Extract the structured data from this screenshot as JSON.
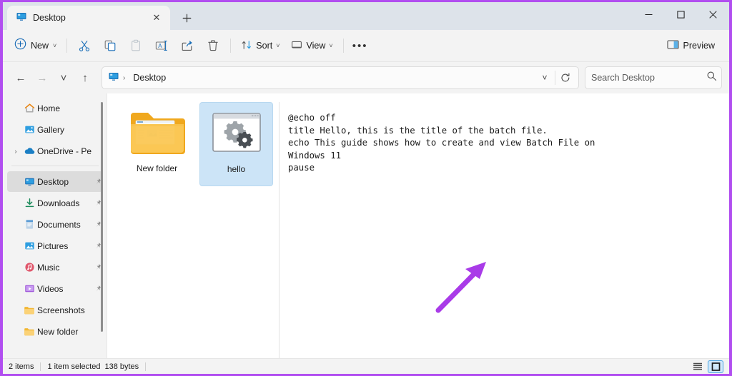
{
  "window": {
    "annotation_color": "#a93be8",
    "accent_color": "#0f6cbd",
    "selection_color": "#cce4f7"
  },
  "tabs": {
    "items": [
      {
        "label": "Desktop",
        "icon": "desktop-monitor-icon",
        "active": true
      }
    ],
    "close_glyph": "✕",
    "new_tab_glyph": "＋"
  },
  "window_controls": {
    "minimize": "Minimize",
    "maximize": "Maximize",
    "close": "Close"
  },
  "toolbar": {
    "new_label": "New",
    "new_icon": "plus-circle-icon",
    "chevron": "˅",
    "buttons": [
      {
        "name": "cut",
        "label": "Cut",
        "icon": "scissors-icon",
        "disabled": false
      },
      {
        "name": "copy",
        "label": "Copy",
        "icon": "copy-icon",
        "disabled": false
      },
      {
        "name": "paste",
        "label": "Paste",
        "icon": "clipboard-icon",
        "disabled": true
      },
      {
        "name": "rename",
        "label": "Rename",
        "icon": "rename-icon",
        "disabled": false
      },
      {
        "name": "share",
        "label": "Share",
        "icon": "share-icon",
        "disabled": false
      },
      {
        "name": "delete",
        "label": "Delete",
        "icon": "trash-icon",
        "disabled": false
      }
    ],
    "sort_label": "Sort",
    "sort_icon": "sort-arrows-icon",
    "view_label": "View",
    "view_icon": "monitor-icon",
    "overflow_label": "•••",
    "preview_label": "Preview",
    "preview_icon": "preview-pane-icon"
  },
  "address_bar": {
    "back_glyph": "←",
    "forward_glyph": "→",
    "recent_glyph": "˅",
    "up_glyph": "↑",
    "breadcrumb": {
      "icon": "desktop-monitor-icon",
      "separator": "›",
      "path": "Desktop"
    },
    "dropdown_glyph": "˅",
    "refresh_glyph": "⟳"
  },
  "search": {
    "placeholder": "Search Desktop",
    "value": "",
    "icon": "search-icon"
  },
  "sidebar": {
    "items": [
      {
        "label": "Home",
        "icon": "home-icon",
        "pinned": false,
        "expandable": false,
        "selected": false
      },
      {
        "label": "Gallery",
        "icon": "gallery-icon",
        "pinned": false,
        "expandable": false,
        "selected": false
      },
      {
        "label": "OneDrive - Pers",
        "icon": "onedrive-cloud-icon",
        "pinned": false,
        "expandable": true,
        "selected": false
      },
      {
        "divider": true
      },
      {
        "label": "Desktop",
        "icon": "desktop-monitor-icon",
        "pinned": true,
        "expandable": false,
        "selected": true
      },
      {
        "label": "Downloads",
        "icon": "download-icon",
        "pinned": true,
        "expandable": false,
        "selected": false
      },
      {
        "label": "Documents",
        "icon": "document-icon",
        "pinned": true,
        "expandable": false,
        "selected": false
      },
      {
        "label": "Pictures",
        "icon": "pictures-icon",
        "pinned": true,
        "expandable": false,
        "selected": false
      },
      {
        "label": "Music",
        "icon": "music-icon",
        "pinned": true,
        "expandable": false,
        "selected": false
      },
      {
        "label": "Videos",
        "icon": "video-icon",
        "pinned": true,
        "expandable": false,
        "selected": false
      },
      {
        "label": "Screenshots",
        "icon": "folder-icon",
        "pinned": false,
        "expandable": false,
        "selected": false
      },
      {
        "label": "New folder",
        "icon": "folder-icon",
        "pinned": false,
        "expandable": false,
        "selected": false
      }
    ],
    "pin_glyph": "📌",
    "expander_glyph": "›"
  },
  "files": {
    "items": [
      {
        "name": "New folder",
        "icon": "folder-with-preview-icon",
        "selected": false
      },
      {
        "name": "hello",
        "icon": "batch-file-gears-icon",
        "selected": true
      }
    ]
  },
  "preview": {
    "content": "@echo off\ntitle Hello, this is the title of the batch file.\necho This guide shows how to create and view Batch File on Windows 11\npause"
  },
  "status_bar": {
    "item_count": "2 items",
    "selection": "1 item selected",
    "size": "138 bytes",
    "view_buttons": [
      {
        "name": "details-view",
        "label": "Details view",
        "active": false
      },
      {
        "name": "large-icons-view",
        "label": "Large icons view",
        "active": true
      }
    ]
  }
}
